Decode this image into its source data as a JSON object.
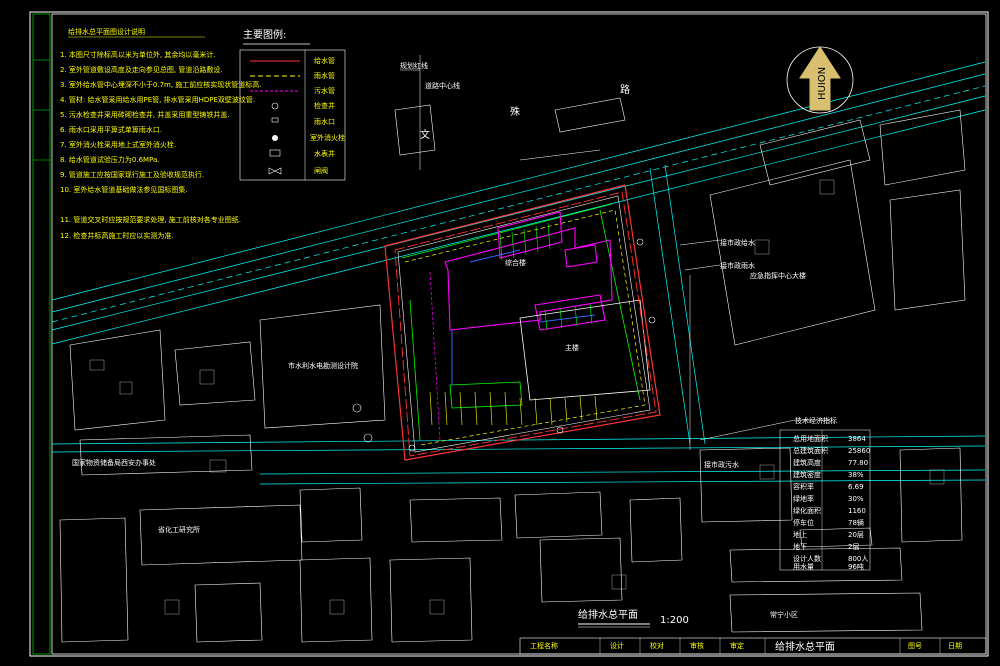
{
  "notes": {
    "title": "给排水总平面图设计说明",
    "lines": [
      "1. 本图尺寸除标高以米为单位外, 其余均以毫米计.",
      "2. 室外管道敷设高度及走向参见总图, 管道沿路敷设.",
      "3. 室外给水管中心埋深不小于0.7m, 施工前应核实现状管道标高.",
      "4. 管材: 给水管采用给水用PE管, 排水管采用HDPE双壁波纹管.",
      "5. 污水检查井采用砖砌检查井, 井盖采用重型铸铁井盖.",
      "6. 雨水口采用平箅式单箅雨水口.",
      "7. 室外消火栓采用地上式室外消火栓.",
      "8. 给水管道试验压力为0.6MPa.",
      "9. 管道施工应按国家现行施工及验收规范执行.",
      "10. 室外给水管道基础做法参见国标图集.",
      "11. 管道交叉时应按规范要求处理, 施工前核对各专业图纸.",
      "12. 检查井标高施工时应以实测为准."
    ]
  },
  "legend": {
    "title": "主要图例:",
    "items": [
      {
        "label": "给水管",
        "color": "#ff3333"
      },
      {
        "label": "雨水管",
        "color": "#ffff00"
      },
      {
        "label": "污水管",
        "color": "#ff00ff"
      },
      {
        "label": "检查井",
        "color": "#ffffff"
      },
      {
        "label": "雨水口",
        "color": "#ffffff"
      },
      {
        "label": "室外消火栓",
        "color": "#ffffff"
      },
      {
        "label": "水表井",
        "color": "#ffffff"
      },
      {
        "label": "闸阀",
        "color": "#ffffff"
      }
    ]
  },
  "compass": {
    "label": "HUION"
  },
  "map_labels": {
    "road": [
      "文",
      "殊",
      "路"
    ],
    "left_building": "市水利水电勘测设计院",
    "bureau": "国家物资储备局西安办事处",
    "institute": "省化工研究所",
    "center_tower": "应急指挥中心大楼",
    "residential": "常宁小区",
    "building_a": "综合楼",
    "building_b": "主楼",
    "north_note_1": "规划红线",
    "north_note_2": "道路中心线",
    "right_note_1": "接市政给水",
    "right_note_2": "接市政雨水",
    "right_note_3": "接市政污水"
  },
  "tech_table": {
    "title": "技术经济指标",
    "rows": [
      {
        "k": "总用地面积",
        "v": "3864"
      },
      {
        "k": "总建筑面积",
        "v": "25860"
      },
      {
        "k": "建筑高度",
        "v": "77.80"
      },
      {
        "k": "建筑密度",
        "v": "38%"
      },
      {
        "k": "容积率",
        "v": "6.69"
      },
      {
        "k": "绿地率",
        "v": "30%"
      },
      {
        "k": "绿化面积",
        "v": "1160"
      },
      {
        "k": "停车位",
        "v": "78辆"
      },
      {
        "k": "地上",
        "v": "20层"
      },
      {
        "k": "地下",
        "v": "2层"
      },
      {
        "k": "设计人数",
        "v": "800人"
      },
      {
        "k": "用水量",
        "v": "96吨"
      }
    ]
  },
  "drawing_title": {
    "main": "给排水总平面",
    "scale": "1:200"
  },
  "title_block": {
    "drawing_name": "给排水总平面",
    "cells": [
      "工程名称",
      "设计",
      "校对",
      "审核",
      "审定",
      "图号",
      "日期"
    ]
  },
  "colors": {
    "background": "#000000",
    "frame": "#ffffff",
    "water_supply": "#ff3333",
    "rain": "#ffff00",
    "sewage": "#ff00ff",
    "building": "#ff00ff",
    "road_line": "#00ffff",
    "site_line": "#ff3333",
    "green": "#00ff00"
  }
}
